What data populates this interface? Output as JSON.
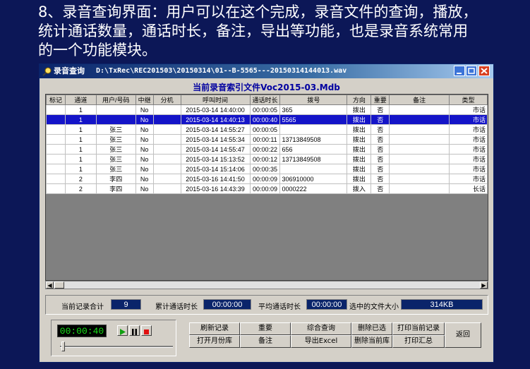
{
  "slide": {
    "line1": "8、录音查询界面：用户可以在这个完成，录音文件的查询，播放，",
    "line2": "统计通话数量，通话时长，备注，导出等功能，也是录音系统常用",
    "line3": "的一个功能模块。"
  },
  "window": {
    "title": "录音查询",
    "path": "D:\\TxRec\\REC201503\\20150314\\01--B-5565---20150314144013.wav"
  },
  "grid_title": "当前录音索引文件Voc2015-03.Mdb",
  "table": {
    "headers": [
      "标记",
      "通道",
      "用户/号码",
      "中继",
      "分机",
      "呼叫时间",
      "通话时长",
      "拨号",
      "方向",
      "重要",
      "备注",
      "类型"
    ],
    "rows": [
      [
        "",
        "1",
        "",
        "No",
        "",
        "2015-03-14 14:40:00",
        "00:00:05",
        "365",
        "拨出",
        "否",
        "",
        "市话"
      ],
      [
        "",
        "1",
        "",
        "No",
        "",
        "2015-03-14 14:40:13",
        "00:00:40",
        "5565",
        "拨出",
        "否",
        "",
        "市话"
      ],
      [
        "",
        "1",
        "张三",
        "No",
        "",
        "2015-03-14 14:55:27",
        "00:00:05",
        "",
        "拨出",
        "否",
        "",
        "市话"
      ],
      [
        "",
        "1",
        "张三",
        "No",
        "",
        "2015-03-14 14:55:34",
        "00:00:11",
        "13713849508",
        "拨出",
        "否",
        "",
        "市话"
      ],
      [
        "",
        "1",
        "张三",
        "No",
        "",
        "2015-03-14 14:55:47",
        "00:00:22",
        "656",
        "拨出",
        "否",
        "",
        "市话"
      ],
      [
        "",
        "1",
        "张三",
        "No",
        "",
        "2015-03-14 15:13:52",
        "00:00:12",
        "13713849508",
        "拨出",
        "否",
        "",
        "市话"
      ],
      [
        "",
        "1",
        "张三",
        "No",
        "",
        "2015-03-14 15:14:06",
        "00:00:35",
        "",
        "拨出",
        "否",
        "",
        "市话"
      ],
      [
        "",
        "2",
        "李四",
        "No",
        "",
        "2015-03-16 14:41:50",
        "00:00:09",
        "306910000",
        "拨出",
        "否",
        "",
        "市话"
      ],
      [
        "",
        "2",
        "李四",
        "No",
        "",
        "2015-03-16 14:43:39",
        "00:00:09",
        "0000222",
        "拨入",
        "否",
        "",
        "长话"
      ]
    ],
    "selected_row": 1
  },
  "stats": {
    "record_total_label": "当前记录合计",
    "record_total": "9",
    "total_duration_label": "累计通话时长",
    "total_duration": "00:00:00",
    "avg_duration_label": "平均通话时长",
    "avg_duration": "00:00:00",
    "selected_size_label": "选中的文件大小",
    "selected_size": "314KB"
  },
  "player": {
    "time": "00:00:40"
  },
  "buttons": {
    "refresh": "刷新记录",
    "important": "重要",
    "query": "综合查询",
    "delete_selected": "删除已选",
    "print_current": "打印当前记录",
    "back": "返回",
    "open_month": "打开月份库",
    "note": "备注",
    "export_excel": "导出Excel",
    "delete_db": "删除当前库",
    "print_summary": "打印汇总"
  },
  "colors": {
    "slide_bg": "#0c1757",
    "selected_row": "#1414c8",
    "value_box": "#0a246a",
    "time_digits": "#18e018"
  }
}
